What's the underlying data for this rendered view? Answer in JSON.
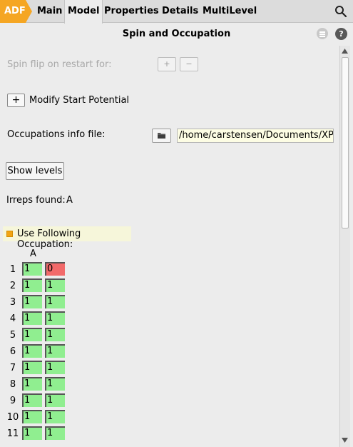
{
  "tabs": {
    "brand": "ADF",
    "items": [
      "Main",
      "Model",
      "Properties",
      "Details",
      "MultiLevel"
    ],
    "active": "Model"
  },
  "panel": {
    "title": "Spin and Occupation"
  },
  "spin_flip": {
    "label": "Spin flip on restart for:",
    "add_symbol": "+",
    "remove_symbol": "−"
  },
  "modify_start": {
    "button_symbol": "+",
    "label": "Modify Start Potential"
  },
  "occupations": {
    "label": "Occupations info file:",
    "path": "/home/carstensen/Documents/XPS/i"
  },
  "show_levels": {
    "label": "Show levels"
  },
  "irreps": {
    "label": "Irreps found:",
    "value": "A"
  },
  "use_following": {
    "label": "Use Following Occupation:"
  },
  "occupation_table": {
    "column_header": "A",
    "rows": [
      {
        "num": "1",
        "alpha": "1",
        "beta": "0",
        "beta_color": "#f26a6a"
      },
      {
        "num": "2",
        "alpha": "1",
        "beta": "1",
        "beta_color": "#90ee90"
      },
      {
        "num": "3",
        "alpha": "1",
        "beta": "1",
        "beta_color": "#90ee90"
      },
      {
        "num": "4",
        "alpha": "1",
        "beta": "1",
        "beta_color": "#90ee90"
      },
      {
        "num": "5",
        "alpha": "1",
        "beta": "1",
        "beta_color": "#90ee90"
      },
      {
        "num": "6",
        "alpha": "1",
        "beta": "1",
        "beta_color": "#90ee90"
      },
      {
        "num": "7",
        "alpha": "1",
        "beta": "1",
        "beta_color": "#90ee90"
      },
      {
        "num": "8",
        "alpha": "1",
        "beta": "1",
        "beta_color": "#90ee90"
      },
      {
        "num": "9",
        "alpha": "1",
        "beta": "1",
        "beta_color": "#90ee90"
      },
      {
        "num": "10",
        "alpha": "1",
        "beta": "1",
        "beta_color": "#90ee90"
      },
      {
        "num": "11",
        "alpha": "1",
        "beta": "1",
        "beta_color": "#90ee90"
      }
    ]
  },
  "colors": {
    "brand": "#f5a623",
    "cell_ok": "#90ee90",
    "cell_warn": "#f26a6a",
    "checkbox": "#f2a414"
  },
  "icons": {
    "search": "search-icon",
    "menu": "menu-icon",
    "help": "help-icon",
    "folder": "folder-icon"
  }
}
